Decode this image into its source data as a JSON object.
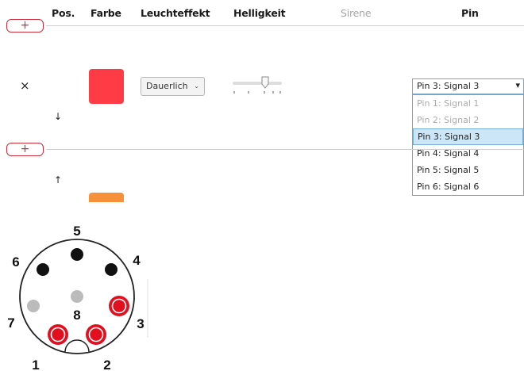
{
  "header": {
    "pos": "Pos.",
    "farbe": "Farbe",
    "leuchteffekt": "Leuchteffekt",
    "helligkeit": "Helligkeit",
    "sirene": "Sirene",
    "pin": "Pin"
  },
  "add_label": "+",
  "rows": [
    {
      "delete_label": "×",
      "arrow_down": "↓",
      "color": "#ff3b45",
      "effect": "Dauerlich",
      "effect_chevron": "⌄",
      "brightness": 0.75,
      "pin": "Pin 3: Signal 3",
      "pin_caret": "▾"
    },
    {
      "arrow_up": "↑",
      "color": "#f7903b"
    }
  ],
  "pin_options": [
    {
      "label": "Pin 1: Signal 1",
      "state": "disabled"
    },
    {
      "label": "Pin 2: Signal 2",
      "state": "disabled"
    },
    {
      "label": "Pin 3: Signal 3",
      "state": "selected"
    },
    {
      "label": "Pin 4: Signal 4",
      "state": "normal"
    },
    {
      "label": "Pin 5: Signal 5",
      "state": "normal"
    },
    {
      "label": "Pin 6: Signal 6",
      "state": "normal"
    }
  ],
  "connector": {
    "labels": [
      "1",
      "2",
      "3",
      "4",
      "5",
      "6",
      "7",
      "8"
    ],
    "pin_states": {
      "1": "active",
      "2": "active",
      "3": "active",
      "4": "black",
      "5": "black",
      "6": "black",
      "7": "grey",
      "8": "grey"
    },
    "colors": {
      "active": "#e2101e",
      "black": "#111111",
      "grey": "#bbbbbb"
    }
  }
}
